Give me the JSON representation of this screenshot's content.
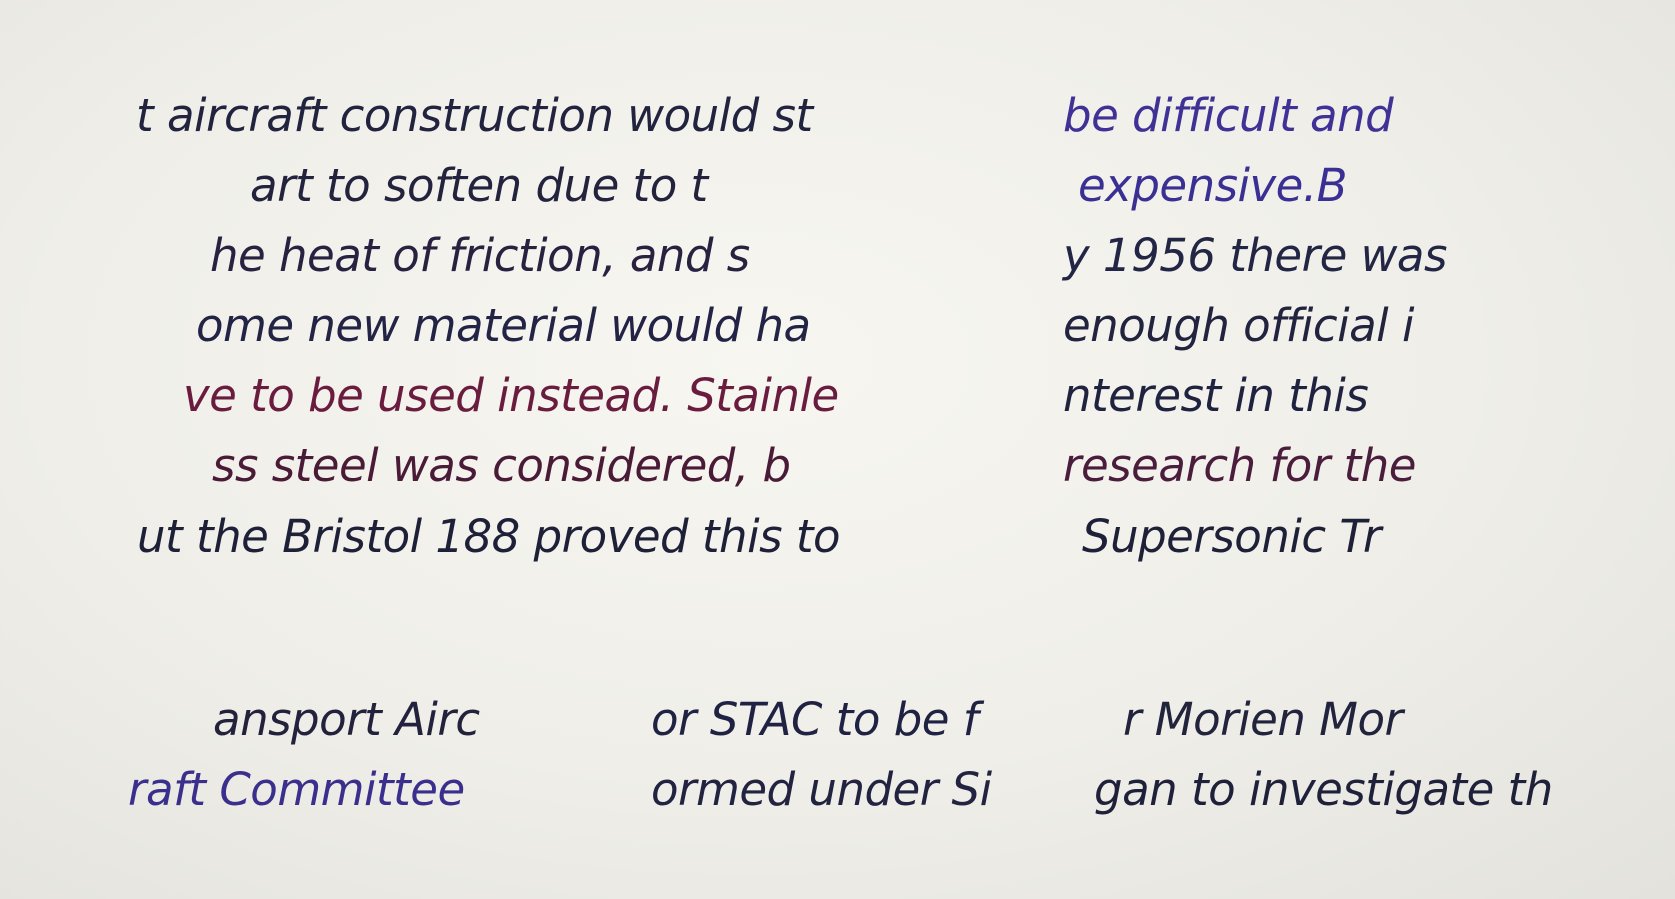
{
  "colors": {
    "dark_navy": "#1f2340",
    "maroon": "#6a1c3e",
    "violet": "#3f3196",
    "background": "#efeee8"
  },
  "top_left": {
    "lines": [
      "t aircraft construction would st",
      "art to soften due to t",
      "he heat of friction, and s",
      "ome new material would ha",
      "ve to be used instead. Stainle",
      "ss steel was considered, b",
      "ut the Bristol 188 proved this to"
    ]
  },
  "top_right": {
    "lines": [
      "be difficult and",
      "expensive.B",
      "y 1956 there was",
      "enough official i",
      "nterest in this",
      "research for the",
      "Supersonic Tr"
    ]
  },
  "bottom": {
    "col1": [
      "ansport Airc",
      "raft Committee"
    ],
    "col2": [
      "or STAC to be f",
      "ormed under Si"
    ],
    "col3": [
      "r Morien Mor",
      "gan to investigate th"
    ]
  }
}
